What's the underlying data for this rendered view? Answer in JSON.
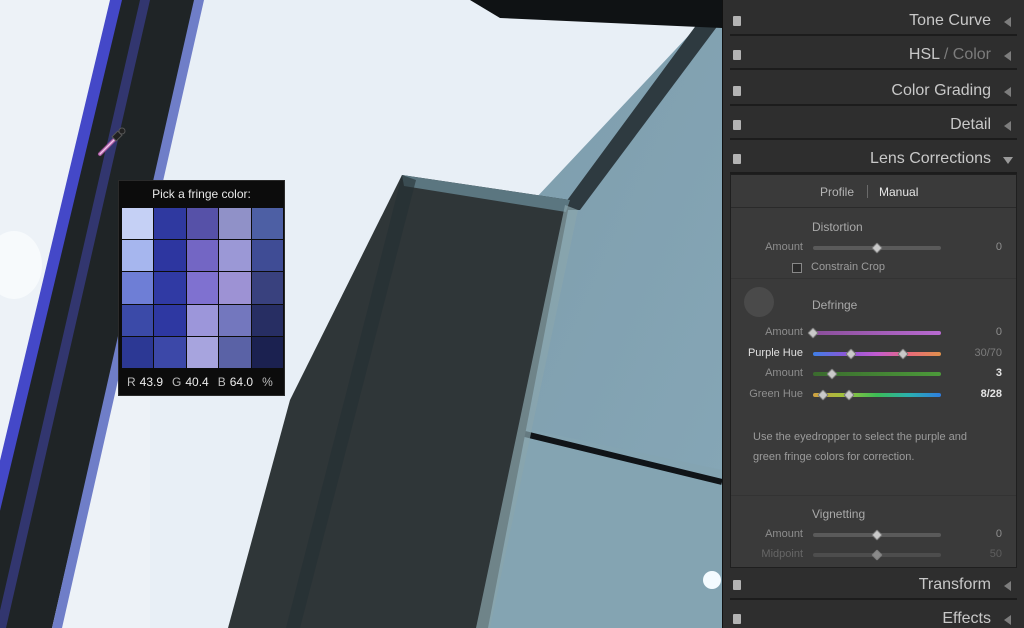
{
  "picker": {
    "title": "Pick a fringe color:",
    "swatches": [
      "#c5d0f5",
      "#2f39a0",
      "#5651a8",
      "#9091c8",
      "#4d5fa4",
      "#a6b6ee",
      "#2d36a0",
      "#7366c4",
      "#9b98d6",
      "#3f4c95",
      "#6e7ed6",
      "#303aa4",
      "#7f71d0",
      "#9d92d4",
      "#39417e",
      "#3b4aa8",
      "#2e38a2",
      "#9c96da",
      "#7377be",
      "#272e63",
      "#2c3894",
      "#3c48a8",
      "#a7a4de",
      "#5a62a6",
      "#1b2150"
    ],
    "r_label": "R",
    "r_value": "43.9",
    "g_label": "G",
    "g_value": "40.4",
    "b_label": "B",
    "b_value": "64.0",
    "unit": "%"
  },
  "panel": {
    "sections": {
      "tone_curve": "Tone Curve",
      "hsl_a": "HSL",
      "hsl_sep": " / ",
      "hsl_b": "Color",
      "color_grading": "Color Grading",
      "detail": "Detail",
      "lens_corrections": "Lens Corrections",
      "transform": "Transform",
      "effects": "Effects"
    },
    "lens": {
      "tab_profile": "Profile",
      "tab_manual": "Manual",
      "distortion": {
        "title": "Distortion",
        "amount_label": "Amount",
        "amount_value": "0",
        "amount_level": 0.5,
        "constrain_crop": "Constrain Crop"
      },
      "defringe": {
        "title": "Defringe",
        "purple_amount_label": "Amount",
        "purple_amount_value": "0",
        "purple_amount_level": 0.0,
        "purple_hue_label": "Purple Hue",
        "purple_hue_value": "30/70",
        "purple_hue_low": 30,
        "purple_hue_high": 70,
        "green_amount_label": "Amount",
        "green_amount_value": "3",
        "green_amount_level": 0.15,
        "green_hue_label": "Green Hue",
        "green_hue_value": "8/28",
        "green_hue_low": 8,
        "green_hue_high": 28,
        "help_text": "Use the eyedropper to select the purple and green fringe colors for correction."
      },
      "vignetting": {
        "title": "Vignetting",
        "amount_label": "Amount",
        "amount_value": "0",
        "amount_level": 0.5,
        "midpoint_label": "Midpoint",
        "midpoint_value": "50",
        "midpoint_level": 0.5
      }
    }
  },
  "icons": {
    "eyedropper": "eyedropper-icon",
    "panel_toggle": "panel-switch-icon",
    "collapse": "collapse-arrow-icon"
  }
}
